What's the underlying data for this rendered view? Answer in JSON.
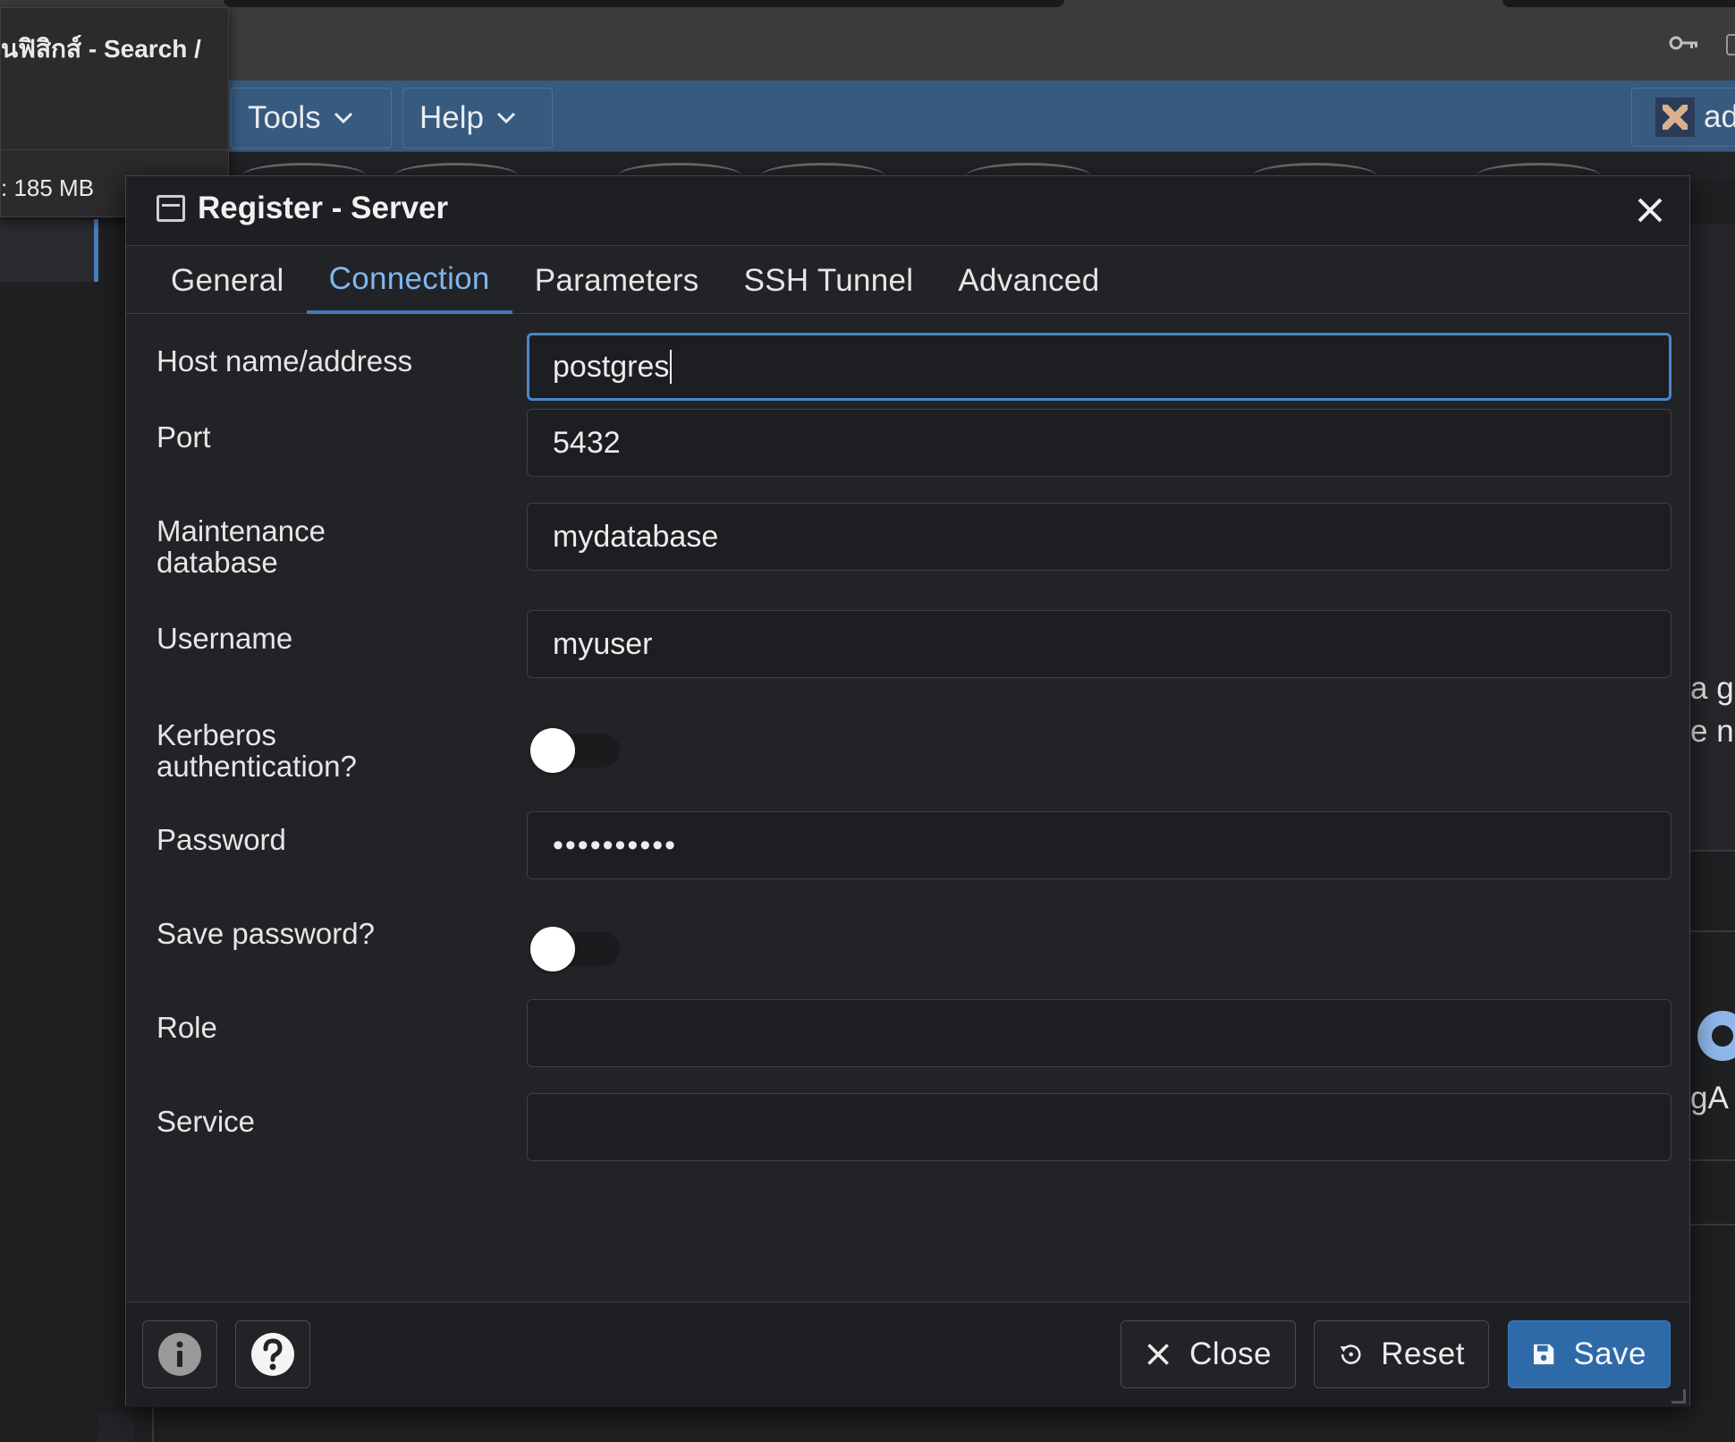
{
  "browser": {
    "popover_title": "นฟิสิกส์ - Search /",
    "popover_memory": ": 185 MB"
  },
  "menubar": {
    "tools_label": "Tools",
    "help_label": "Help",
    "user_label": "ad"
  },
  "background": {
    "side_text_1": "a g",
    "side_text_2": "e n",
    "side_text_3": "gA"
  },
  "dialog": {
    "title": "Register - Server",
    "tabs": [
      {
        "label": "General"
      },
      {
        "label": "Connection"
      },
      {
        "label": "Parameters"
      },
      {
        "label": "SSH Tunnel"
      },
      {
        "label": "Advanced"
      }
    ],
    "active_tab": "Connection",
    "fields": {
      "host": {
        "label": "Host name/address",
        "value": "postgres"
      },
      "port": {
        "label": "Port",
        "value": "5432"
      },
      "maintenance_db": {
        "label": "Maintenance database",
        "value": "mydatabase"
      },
      "username": {
        "label": "Username",
        "value": "myuser"
      },
      "kerberos": {
        "label": "Kerberos authentication?",
        "value": "off"
      },
      "password": {
        "label": "Password",
        "value": "••••••••••"
      },
      "save_password": {
        "label": "Save password?",
        "value": "off"
      },
      "role": {
        "label": "Role",
        "value": ""
      },
      "service": {
        "label": "Service",
        "value": ""
      }
    },
    "footer": {
      "close_label": "Close",
      "reset_label": "Reset",
      "save_label": "Save"
    }
  },
  "colors": {
    "menubar_bg": "#375a7f",
    "accent": "#3f79b8",
    "active_tab_text": "#7fb6ef",
    "save_button": "#2f6aa8"
  }
}
